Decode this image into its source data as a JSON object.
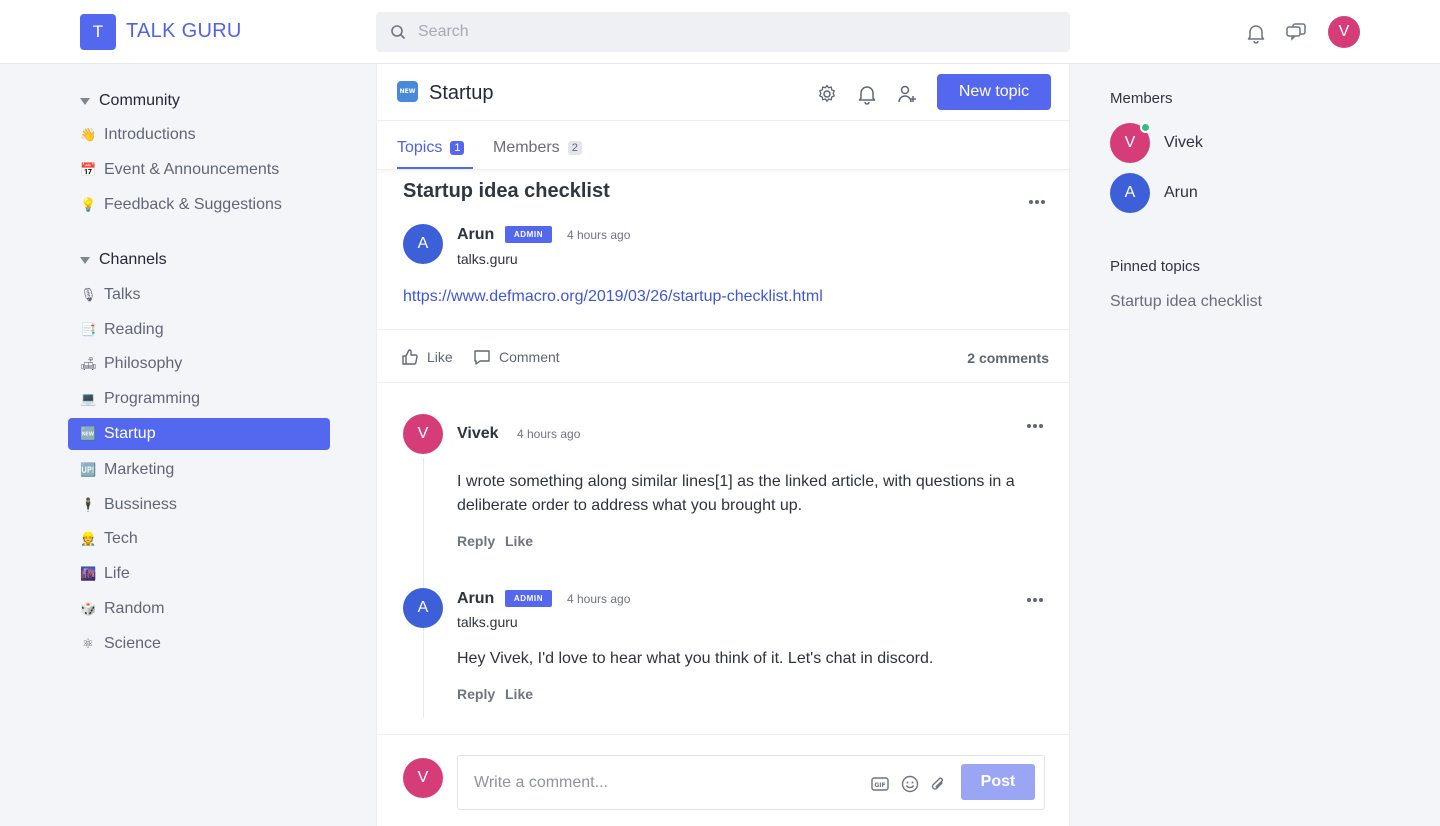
{
  "app": {
    "logo_letter": "T",
    "name": "TALK GURU"
  },
  "search": {
    "placeholder": "Search"
  },
  "user": {
    "initial": "V"
  },
  "sidebar": {
    "community": {
      "title": "Community",
      "items": [
        {
          "emoji": "👋",
          "label": "Introductions"
        },
        {
          "emoji": "📅",
          "label": "Event & Announcements"
        },
        {
          "emoji": "💡",
          "label": "Feedback & Suggestions"
        }
      ]
    },
    "channels": {
      "title": "Channels",
      "items": [
        {
          "emoji": "🎙",
          "label": "Talks"
        },
        {
          "emoji": "📑",
          "label": "Reading"
        },
        {
          "emoji": "🛋",
          "label": "Philosophy"
        },
        {
          "emoji": "💻",
          "label": "Programming"
        },
        {
          "emoji": "🆕",
          "label": "Startup",
          "active": true
        },
        {
          "emoji": "🆙",
          "label": "Marketing"
        },
        {
          "emoji": "🕴",
          "label": "Bussiness"
        },
        {
          "emoji": "👷",
          "label": "Tech"
        },
        {
          "emoji": "🌆",
          "label": "Life"
        },
        {
          "emoji": "🎲",
          "label": "Random"
        },
        {
          "emoji": "⚛",
          "label": "Science"
        }
      ]
    }
  },
  "channel": {
    "badge": "NEW",
    "title": "Startup",
    "new_topic_label": "New topic",
    "tabs": [
      {
        "label": "Topics",
        "count": "1"
      },
      {
        "label": "Members",
        "count": "2"
      }
    ]
  },
  "post": {
    "title": "Startup idea checklist",
    "author": {
      "initial": "A",
      "name": "Arun",
      "badge": "ADMIN",
      "time": "4 hours ago",
      "subtitle": "talks.guru"
    },
    "link": "https://www.defmacro.org/2019/03/26/startup-checklist.html",
    "like_label": "Like",
    "comment_label": "Comment",
    "comments_count": "2 comments"
  },
  "comments": [
    {
      "initial": "V",
      "name": "Vivek",
      "time": "4 hours ago",
      "text": "I wrote something along similar lines[1] as the linked article, with questions in a deliberate order to address what you brought up.",
      "reply_label": "Reply",
      "like_label": "Like"
    },
    {
      "initial": "A",
      "name": "Arun",
      "badge": "ADMIN",
      "subtitle": "talks.guru",
      "time": "4 hours ago",
      "text": "Hey Vivek, I'd love to hear what you think of it. Let's chat in discord.",
      "reply_label": "Reply",
      "like_label": "Like"
    }
  ],
  "composer": {
    "initial": "V",
    "placeholder": "Write a comment...",
    "post_label": "Post"
  },
  "right_panel": {
    "members_title": "Members",
    "members": [
      {
        "initial": "V",
        "name": "Vivek",
        "online": true
      },
      {
        "initial": "A",
        "name": "Arun"
      }
    ],
    "pinned_title": "Pinned topics",
    "pinned": [
      "Startup idea checklist"
    ]
  },
  "colors": {
    "accent": "#5468ef",
    "pink_avatar": "#d63c78",
    "blue_avatar": "#3d5fd8",
    "online": "#2fc07a"
  }
}
